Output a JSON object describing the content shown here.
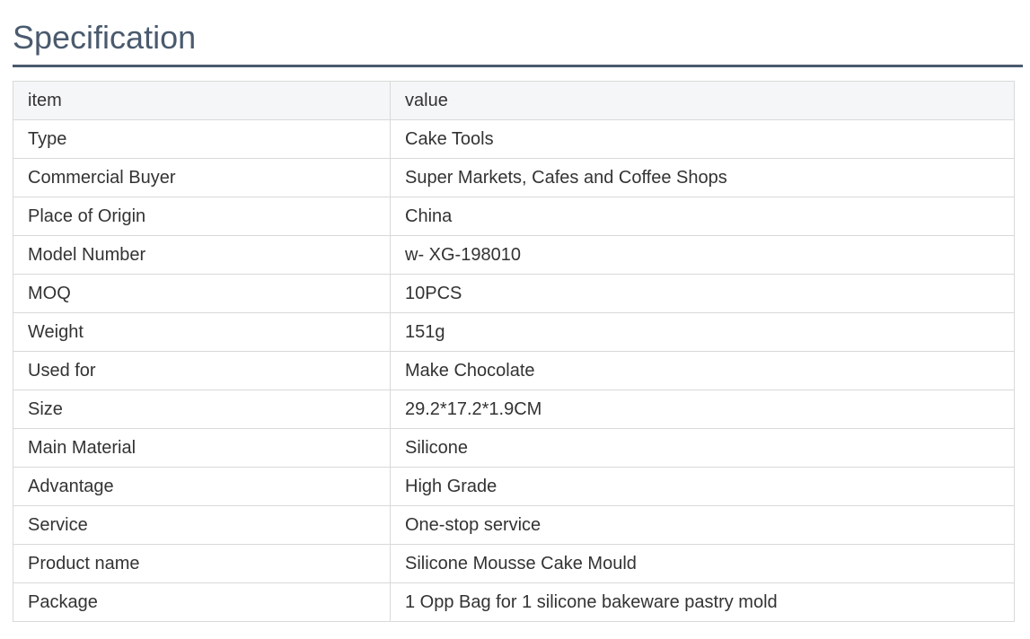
{
  "title": "Specification",
  "table": {
    "header": {
      "item": "item",
      "value": "value"
    },
    "rows": [
      {
        "item": "Type",
        "value": "Cake Tools"
      },
      {
        "item": "Commercial Buyer",
        "value": "Super Markets, Cafes and Coffee Shops"
      },
      {
        "item": "Place of Origin",
        "value": "China"
      },
      {
        "item": "Model Number",
        "value": "w- XG-198010"
      },
      {
        "item": "MOQ",
        "value": "10PCS"
      },
      {
        "item": "Weight",
        "value": "151g"
      },
      {
        "item": "Used for",
        "value": "Make Chocolate"
      },
      {
        "item": "Size",
        "value": "29.2*17.2*1.9CM"
      },
      {
        "item": "Main Material",
        "value": "Silicone"
      },
      {
        "item": "Advantage",
        "value": "High Grade"
      },
      {
        "item": "Service",
        "value": "One-stop service"
      },
      {
        "item": "Product name",
        "value": "Silicone Mousse Cake Mould"
      },
      {
        "item": "Package",
        "value": "1 Opp Bag for 1 silicone bakeware pastry mold"
      }
    ]
  },
  "colors": {
    "title": "#4a5a6e",
    "rule": "#4a5a6e",
    "header_bg": "#f5f6f8",
    "border": "#d9d9d9",
    "text": "#333333"
  }
}
